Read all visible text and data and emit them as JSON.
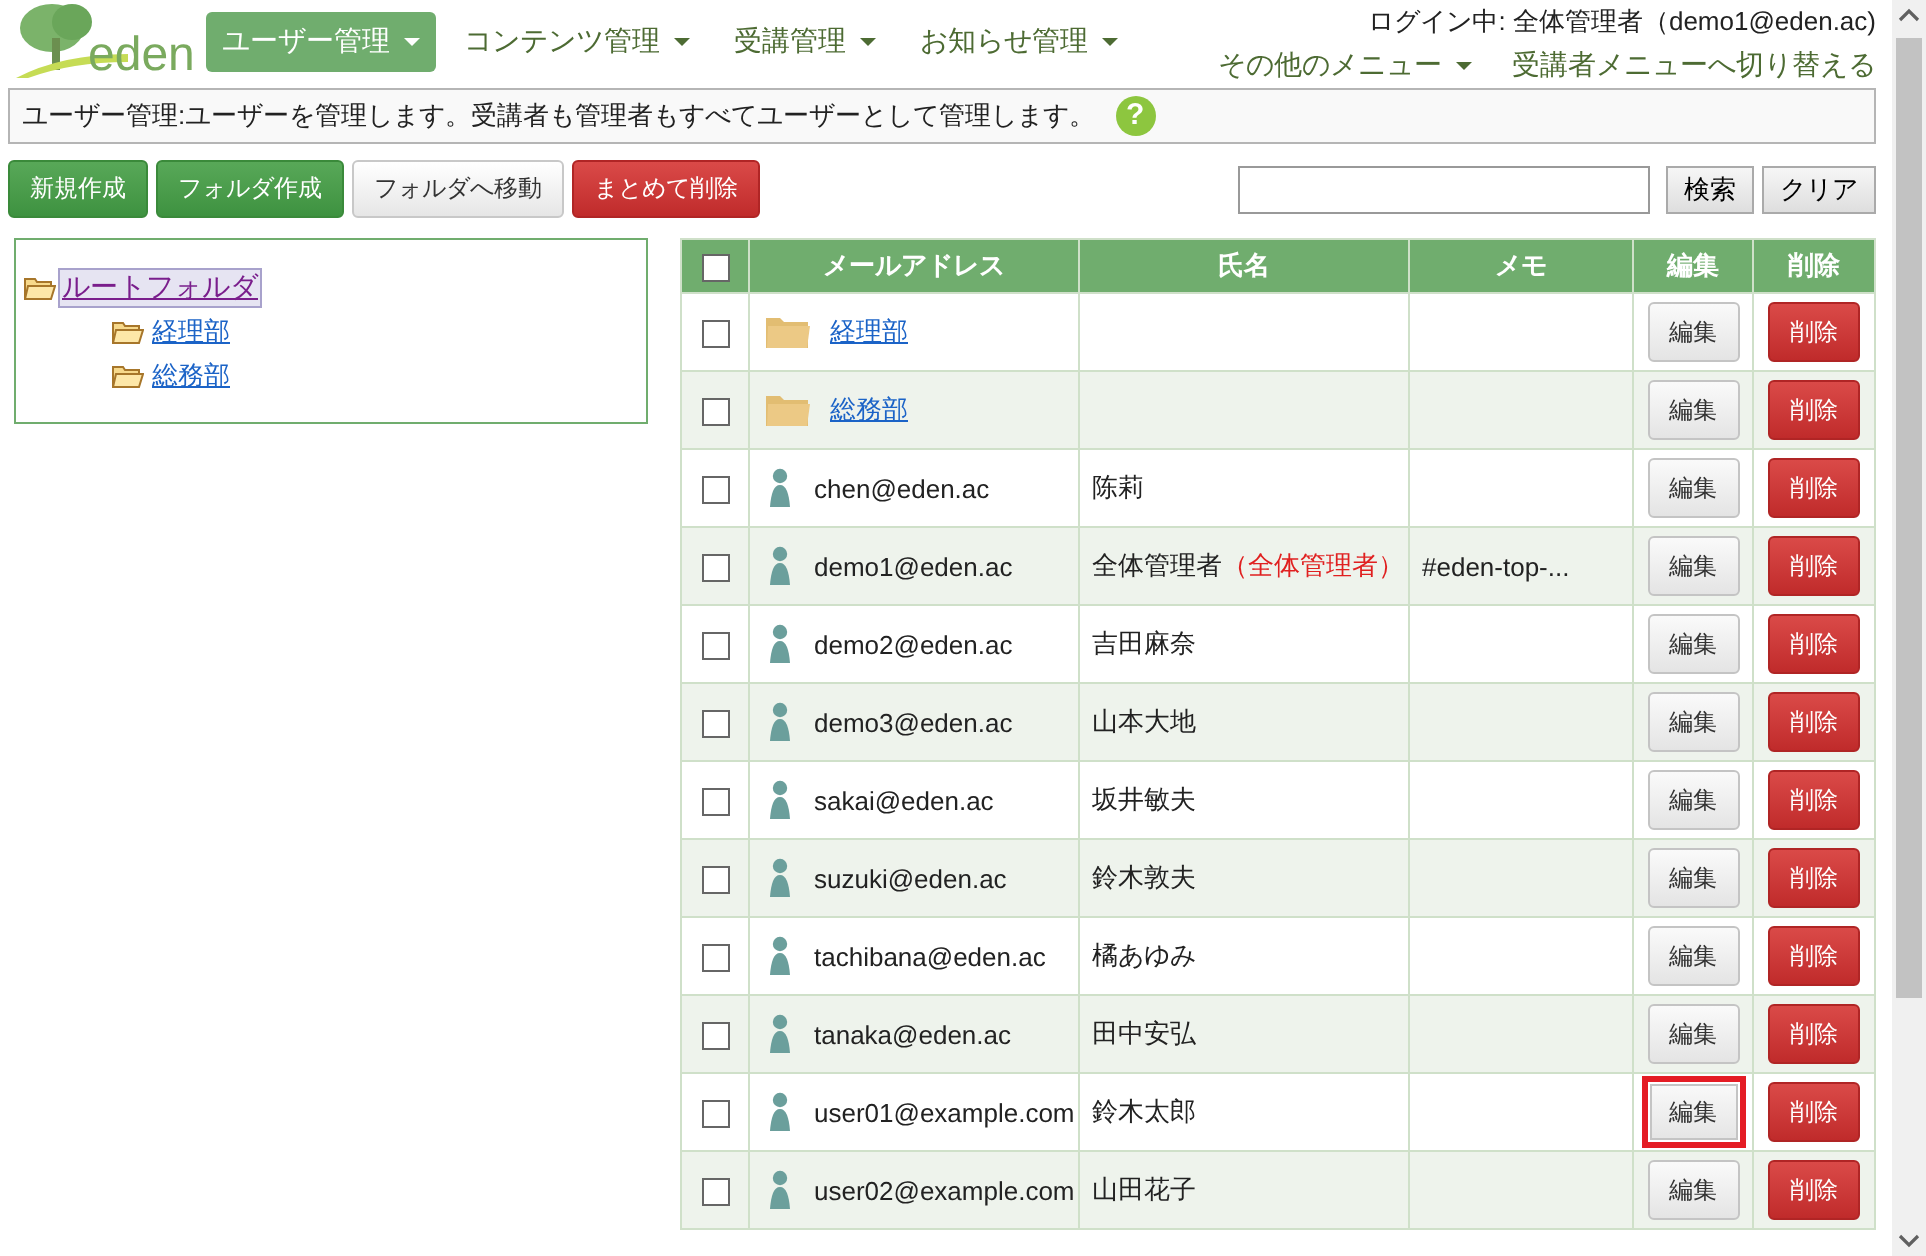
{
  "logo": {
    "text": "eden"
  },
  "nav": [
    {
      "label": "ユーザー管理",
      "selected": true
    },
    {
      "label": "コンテンツ管理",
      "selected": false
    },
    {
      "label": "受講管理",
      "selected": false
    },
    {
      "label": "お知らせ管理",
      "selected": false
    }
  ],
  "login_status": "ログイン中: 全体管理者（demo1@eden.ac)",
  "other_menu": "その他のメニュー",
  "switch_link": "受講者メニューへ切り替える",
  "info_bar": {
    "text": "ユーザー管理:ユーザーを管理します。受講者も管理者もすべてユーザーとして管理します。",
    "help": "?"
  },
  "actions": [
    {
      "label": "新規作成",
      "kind": "green"
    },
    {
      "label": "フォルダ作成",
      "kind": "green"
    },
    {
      "label": "フォルダへ移動",
      "kind": "plain"
    },
    {
      "label": "まとめて削除",
      "kind": "red"
    }
  ],
  "search": {
    "button": "検索",
    "clear": "クリア"
  },
  "tree": {
    "label": "ルートフォルダ",
    "selected": true,
    "children": [
      {
        "label": "経理部"
      },
      {
        "label": "総務部"
      }
    ]
  },
  "table": {
    "select_all_checked": false,
    "columns": [
      "メールアドレス",
      "氏名",
      "メモ",
      "編集",
      "削除"
    ],
    "rows": [
      {
        "kind": "folder",
        "email": "経理部",
        "checked": false,
        "highlighted": false,
        "edit": "編集",
        "delete": "削除"
      },
      {
        "kind": "folder",
        "email": "総務部",
        "checked": false,
        "highlighted": false,
        "edit": "編集",
        "delete": "削除"
      },
      {
        "kind": "user",
        "email": "chen@eden.ac",
        "name": "陈莉",
        "checked": false,
        "highlighted": false,
        "edit": "編集",
        "delete": "削除"
      },
      {
        "kind": "user",
        "email": "demo1@eden.ac",
        "name": "全体管理者",
        "role": "（全体管理者）",
        "memo": "#eden-top-...",
        "checked": false,
        "highlighted": false,
        "edit": "編集",
        "delete": "削除"
      },
      {
        "kind": "user",
        "email": "demo2@eden.ac",
        "name": "吉田麻奈",
        "checked": false,
        "highlighted": false,
        "edit": "編集",
        "delete": "削除"
      },
      {
        "kind": "user",
        "email": "demo3@eden.ac",
        "name": "山本大地",
        "checked": false,
        "highlighted": false,
        "edit": "編集",
        "delete": "削除"
      },
      {
        "kind": "user",
        "email": "sakai@eden.ac",
        "name": "坂井敏夫",
        "checked": false,
        "highlighted": false,
        "edit": "編集",
        "delete": "削除"
      },
      {
        "kind": "user",
        "email": "suzuki@eden.ac",
        "name": "鈴木敦夫",
        "checked": false,
        "highlighted": false,
        "edit": "編集",
        "delete": "削除"
      },
      {
        "kind": "user",
        "email": "tachibana@eden.ac",
        "name": "橘あゆみ",
        "checked": false,
        "highlighted": false,
        "edit": "編集",
        "delete": "削除"
      },
      {
        "kind": "user",
        "email": "tanaka@eden.ac",
        "name": "田中安弘",
        "checked": false,
        "highlighted": false,
        "edit": "編集",
        "delete": "削除"
      },
      {
        "kind": "user",
        "email": "user01@example.com",
        "name": "鈴木太郎",
        "checked": false,
        "highlighted": true,
        "edit": "編集",
        "delete": "削除"
      },
      {
        "kind": "user",
        "email": "user02@example.com",
        "name": "山田花子",
        "checked": false,
        "highlighted": false,
        "edit": "編集",
        "delete": "削除"
      }
    ]
  }
}
